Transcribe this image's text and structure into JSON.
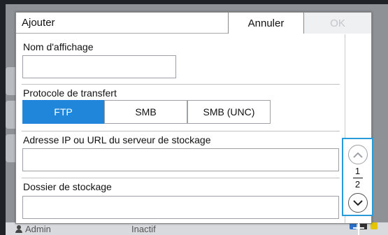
{
  "dialog": {
    "title": "Ajouter",
    "cancel_label": "Annuler",
    "ok_label": "OK"
  },
  "form": {
    "display_name_label": "Nom d'affichage",
    "display_name_value": "",
    "protocol_label": "Protocole de transfert",
    "protocols": [
      "FTP",
      "SMB",
      "SMB (UNC)"
    ],
    "protocol_selected": "FTP",
    "server_label": "Adresse IP ou URL du serveur de stockage",
    "server_value": "",
    "folder_label": "Dossier de stockage",
    "folder_value": ""
  },
  "pager": {
    "current_page": "1",
    "total_pages": "2",
    "up_icon": "chevron-up-icon",
    "down_icon": "chevron-down-icon"
  },
  "status_bar": {
    "user": "Admin",
    "state": "Inactif"
  },
  "colors": {
    "accent": "#1f86d9",
    "highlight_border": "#2a9ad8",
    "disabled_text": "#c2c6ca"
  }
}
